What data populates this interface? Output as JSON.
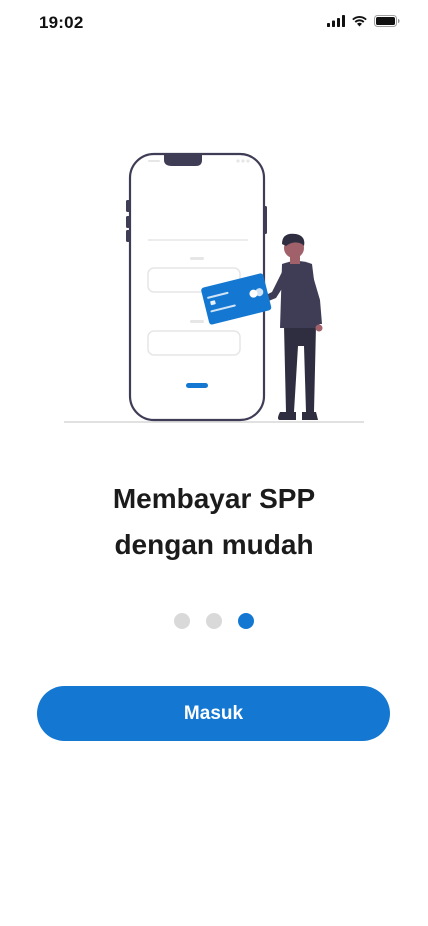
{
  "status_bar": {
    "time": "19:02",
    "icons": [
      "signal-icon",
      "wifi-icon",
      "battery-icon"
    ]
  },
  "onboarding": {
    "illustration": "phone-payment-illustration",
    "headline_line1": "Membayar SPP",
    "headline_line2": "dengan mudah",
    "pagination": {
      "total": 3,
      "active": 3
    }
  },
  "actions": {
    "login_label": "Masuk"
  },
  "colors": {
    "accent": "#1478d2",
    "dot_inactive": "#d9d9d9",
    "text": "#1b1b1b",
    "figure_dark": "#2f2e41"
  }
}
